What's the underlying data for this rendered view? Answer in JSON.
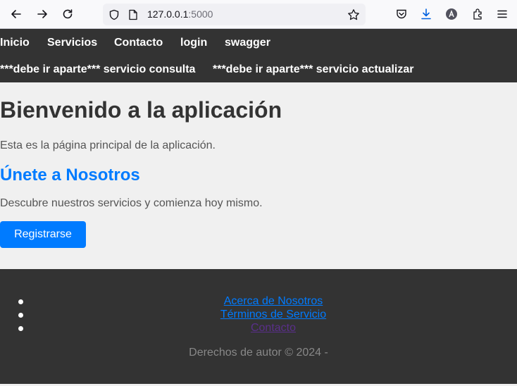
{
  "browser": {
    "url_host": "127.0.0.1",
    "url_port": ":5000"
  },
  "nav": {
    "row1": [
      "Inicio",
      "Servicios",
      "Contacto",
      "login",
      "swagger"
    ],
    "row2": [
      "***debe ir aparte*** servicio consulta",
      "***debe ir aparte*** servicio actualizar"
    ]
  },
  "main": {
    "title": "Bienvenido a la aplicación",
    "description": "Esta es la página principal de la aplicación.",
    "join_title": "Únete a Nosotros",
    "join_description": "Descubre nuestros servicios y comienza hoy mismo.",
    "register_label": "Registrarse"
  },
  "footer": {
    "links": [
      "Acerca de Nosotros",
      "Términos de Servicio",
      "Contacto"
    ],
    "copyright": "Derechos de autor © 2024 -"
  },
  "colors": {
    "nav_bg": "#333333",
    "accent": "#007bff",
    "page_bg": "#f0f0f0"
  }
}
